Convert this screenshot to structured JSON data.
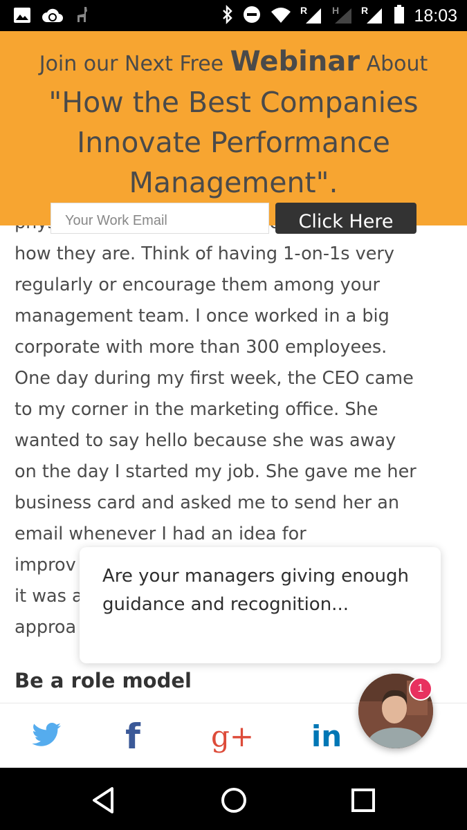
{
  "status_bar": {
    "time": "18:03",
    "icons": [
      "image-icon",
      "cloud-sync-icon",
      "llama-icon",
      "bluetooth-icon",
      "do-not-disturb-icon",
      "wifi-icon",
      "signal-icon",
      "signal-h-icon",
      "signal-r-icon",
      "battery-icon"
    ],
    "signal_labels": [
      "R",
      "H",
      "R"
    ]
  },
  "banner": {
    "line1_pre": "Join our Next Free ",
    "line1_big": "Webinar",
    "line1_post": " About",
    "line2": "\"How the Best Companies",
    "line3": "Innovate Performance",
    "line4": "Management\".",
    "email_placeholder": "Your Work Email",
    "button_label": "Click Here",
    "background": "#f7a531"
  },
  "article": {
    "lines": [
      "physically go to your employees and to ask",
      "how they are. Think of having 1-on-1s very",
      "regularly or encourage them among your",
      "management team. I once worked in a big",
      "corporate with more than 300 employees.",
      "One day during my first week, the CEO came",
      "to my corner in the marketing office. She",
      "wanted to say hello because she was away",
      "on the day I started my job. She gave me her",
      "business card and asked me to send her an",
      "email whenever I had an idea for",
      "improv",
      "it was a",
      "approa"
    ],
    "heading": "Be a role model"
  },
  "chat": {
    "message": "Are your managers giving enough guidance and recognition...",
    "badge_count": "1"
  },
  "share_bar": {
    "buttons": [
      "twitter-icon",
      "facebook-icon",
      "google-plus-icon",
      "linkedin-icon"
    ],
    "facebook_glyph": "f",
    "google_glyph": "g+",
    "linkedin_glyph": "in",
    "colors": {
      "twitter": "#55acee",
      "facebook": "#3b5998",
      "google": "#dd4b39",
      "linkedin": "#0077b5"
    }
  },
  "nav_bar": {
    "buttons": [
      "back-icon",
      "home-icon",
      "recents-icon"
    ]
  }
}
